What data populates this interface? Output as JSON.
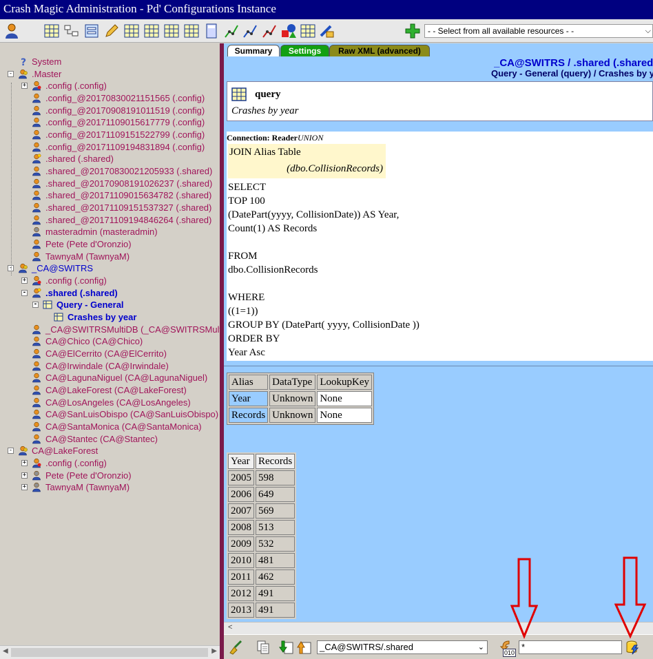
{
  "window": {
    "title": "Crash Magic Administration - Pd' Configurations Instance"
  },
  "toolbar": {
    "resource_select": "- - Select from all available resources - -",
    "icons": [
      "user-icon",
      "table-list-icon",
      "hierarchy-icon",
      "form-icon",
      "pencil-icon",
      "grid-icon",
      "grid-icon",
      "grid-icon",
      "grid-icon",
      "calculator-icon",
      "line-chart-icon",
      "line-chart-icon",
      "line-chart-icon",
      "shapes-icon",
      "grid-edit-icon",
      "tools-icon",
      "add-icon"
    ]
  },
  "tree": {
    "items": [
      {
        "label": "System",
        "depth": 1,
        "type": "system"
      },
      {
        "label": ".Master",
        "depth": 0,
        "type": "group"
      },
      {
        "label": ".config (.config)",
        "depth": 1,
        "type": "config"
      },
      {
        "label": ".config_@20170830021151565 (.config)",
        "depth": 1,
        "type": "user"
      },
      {
        "label": ".config_@20170908191011519 (.config)",
        "depth": 1,
        "type": "user"
      },
      {
        "label": ".config_@20171109015617779 (.config)",
        "depth": 1,
        "type": "user"
      },
      {
        "label": ".config_@20171109151522799 (.config)",
        "depth": 1,
        "type": "user"
      },
      {
        "label": ".config_@20171109194831894 (.config)",
        "depth": 1,
        "type": "user"
      },
      {
        "label": ".shared (.shared)",
        "depth": 1,
        "type": "star"
      },
      {
        "label": ".shared_@20170830021205933 (.shared)",
        "depth": 1,
        "type": "user"
      },
      {
        "label": ".shared_@20170908191026237 (.shared)",
        "depth": 1,
        "type": "user"
      },
      {
        "label": ".shared_@20171109015634782 (.shared)",
        "depth": 1,
        "type": "user"
      },
      {
        "label": ".shared_@20171109151537327 (.shared)",
        "depth": 1,
        "type": "user"
      },
      {
        "label": ".shared_@20171109194846264 (.shared)",
        "depth": 1,
        "type": "user"
      },
      {
        "label": "masteradmin (masteradmin)",
        "depth": 1,
        "type": "admin"
      },
      {
        "label": "Pete (Pete d'Oronzio)",
        "depth": 1,
        "type": "user"
      },
      {
        "label": "TawnyaM (TawnyaM)",
        "depth": 1,
        "type": "user"
      },
      {
        "label": "_CA@SWITRS",
        "depth": 0,
        "type": "group"
      },
      {
        "label": ".config (.config)",
        "depth": 1,
        "type": "config"
      },
      {
        "label": ".shared (.shared)",
        "depth": 1,
        "type": "star"
      },
      {
        "label": "Query - General",
        "depth": 2,
        "type": "query"
      },
      {
        "label": "Crashes by year",
        "depth": 3,
        "type": "query"
      },
      {
        "label": "_CA@SWITRSMultiDB (_CA@SWITRSMultiDB)",
        "depth": 1,
        "type": "user"
      },
      {
        "label": "CA@Chico (CA@Chico)",
        "depth": 1,
        "type": "user"
      },
      {
        "label": "CA@ElCerrito (CA@ElCerrito)",
        "depth": 1,
        "type": "user"
      },
      {
        "label": "CA@Irwindale (CA@Irwindale)",
        "depth": 1,
        "type": "user"
      },
      {
        "label": "CA@LagunaNiguel (CA@LagunaNiguel)",
        "depth": 1,
        "type": "user"
      },
      {
        "label": "CA@LakeForest (CA@LakeForest)",
        "depth": 1,
        "type": "user"
      },
      {
        "label": "CA@LosAngeles (CA@LosAngeles)",
        "depth": 1,
        "type": "user"
      },
      {
        "label": "CA@SanLuisObispo (CA@SanLuisObispo)",
        "depth": 1,
        "type": "user"
      },
      {
        "label": "CA@SantaMonica (CA@SantaMonica)",
        "depth": 1,
        "type": "user"
      },
      {
        "label": "CA@Stantec (CA@Stantec)",
        "depth": 1,
        "type": "user"
      },
      {
        "label": "CA@LakeForest",
        "depth": 0,
        "type": "group"
      },
      {
        "label": ".config (.config)",
        "depth": 1,
        "type": "config"
      },
      {
        "label": "Pete (Pete d'Oronzio)",
        "depth": 1,
        "type": "admin"
      },
      {
        "label": "TawnyaM (TawnyaM)",
        "depth": 1,
        "type": "admin"
      }
    ]
  },
  "tabs": [
    {
      "label": "Summary"
    },
    {
      "label": "Settings"
    },
    {
      "label": "Raw XML (advanced)"
    }
  ],
  "header": {
    "title": "_CA@SWITRS / .shared (.shared)",
    "path": "Query - General (query) / Crashes by year"
  },
  "query": {
    "type": "query",
    "description": "Crashes by year"
  },
  "sql": {
    "connection_label": "Connection: Reader",
    "connection_value": "UNION",
    "join_label": "JOIN Alias Table",
    "join_alias": "(dbo.CollisionRecords)",
    "lines": [
      "SELECT",
      "TOP 100",
      "(DatePart(yyyy, CollisionDate)) AS Year,",
      "Count(1) AS Records",
      "",
      "FROM",
      "dbo.CollisionRecords",
      "",
      "WHERE",
      "((1=1))",
      "GROUP BY (DatePart( yyyy, CollisionDate ))",
      "ORDER BY",
      "Year Asc"
    ]
  },
  "alias_table": {
    "headers": [
      "Alias",
      "DataType",
      "LookupKey"
    ],
    "rows": [
      [
        "Year",
        "Unknown",
        "None"
      ],
      [
        "Records",
        "Unknown",
        "None"
      ]
    ]
  },
  "data_table": {
    "headers": [
      "Year",
      "Records"
    ],
    "rows": [
      [
        "2005",
        "598"
      ],
      [
        "2006",
        "649"
      ],
      [
        "2007",
        "569"
      ],
      [
        "2008",
        "513"
      ],
      [
        "2009",
        "532"
      ],
      [
        "2010",
        "481"
      ],
      [
        "2011",
        "462"
      ],
      [
        "2012",
        "491"
      ],
      [
        "2013",
        "491"
      ]
    ]
  },
  "bottom": {
    "path_select": "_CA@SWITRS/.shared",
    "filter_value": "*",
    "binary_label": "010"
  }
}
